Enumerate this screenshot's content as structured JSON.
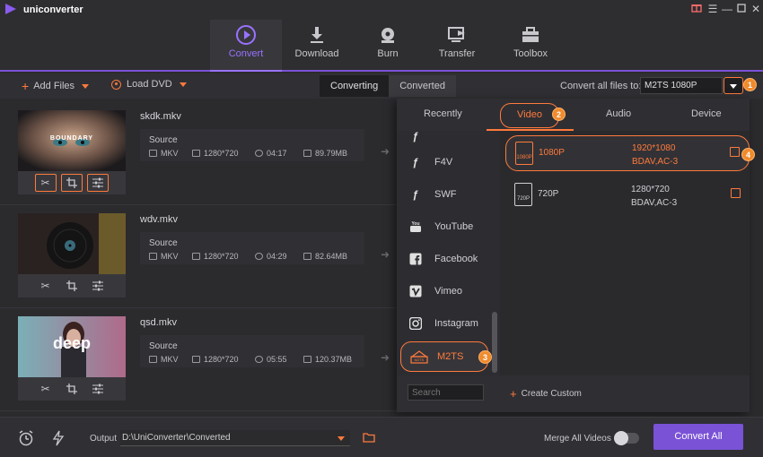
{
  "app": {
    "title": "uniconverter"
  },
  "nav": {
    "tabs": [
      {
        "label": "Convert",
        "icon": "convert-icon",
        "active": true
      },
      {
        "label": "Download",
        "icon": "download-icon"
      },
      {
        "label": "Burn",
        "icon": "burn-icon"
      },
      {
        "label": "Transfer",
        "icon": "transfer-icon"
      },
      {
        "label": "Toolbox",
        "icon": "toolbox-icon"
      }
    ]
  },
  "toolbar": {
    "add_files": "Add Files",
    "load_dvd": "Load DVD",
    "seg_converting": "Converting",
    "seg_converted": "Converted",
    "convert_all_label": "Convert all files to:",
    "format_value": "M2TS 1080P"
  },
  "files": [
    {
      "name": "skdk.mkv",
      "source": "Source",
      "format": "MKV",
      "resolution": "1280*720",
      "duration": "04:17",
      "size": "89.79MB",
      "thumb_text": "BOUNDARY"
    },
    {
      "name": "wdv.mkv",
      "source": "Source",
      "format": "MKV",
      "resolution": "1280*720",
      "duration": "04:29",
      "size": "82.64MB",
      "thumb_text": ""
    },
    {
      "name": "qsd.mkv",
      "source": "Source",
      "format": "MKV",
      "resolution": "1280*720",
      "duration": "05:55",
      "size": "120.37MB",
      "thumb_text": "deep"
    }
  ],
  "panel": {
    "tabs": {
      "recently": "Recently",
      "video": "Video",
      "audio": "Audio",
      "device": "Device"
    },
    "formats": [
      {
        "label": "F4V",
        "icon": "flash-icon"
      },
      {
        "label": "SWF",
        "icon": "flash-icon"
      },
      {
        "label": "YouTube",
        "icon": "youtube-icon"
      },
      {
        "label": "Facebook",
        "icon": "facebook-icon"
      },
      {
        "label": "Vimeo",
        "icon": "vimeo-icon"
      },
      {
        "label": "Instagram",
        "icon": "instagram-icon"
      }
    ],
    "selected_format": "M2TS",
    "selected_format_icon_text": "M2TS",
    "resolutions": [
      {
        "name": "1080P",
        "icon_text": "1080P",
        "spec1": "1920*1080",
        "spec2": "BDAV,AC-3",
        "selected": true
      },
      {
        "name": "720P",
        "icon_text": "720P",
        "spec1": "1280*720",
        "spec2": "BDAV,AC-3",
        "selected": false
      }
    ],
    "search_placeholder": "Search",
    "create_custom": "Create Custom"
  },
  "badges": {
    "b1": "1",
    "b2": "2",
    "b3": "3",
    "b4": "4"
  },
  "bottom": {
    "output_label": "Output",
    "output_path": "D:\\UniConverter\\Converted",
    "merge_label": "Merge All Videos",
    "convert_all": "Convert All"
  },
  "colors": {
    "accent": "#7a52d6",
    "highlight": "#ff7a3c",
    "badge": "#f08b2c"
  }
}
